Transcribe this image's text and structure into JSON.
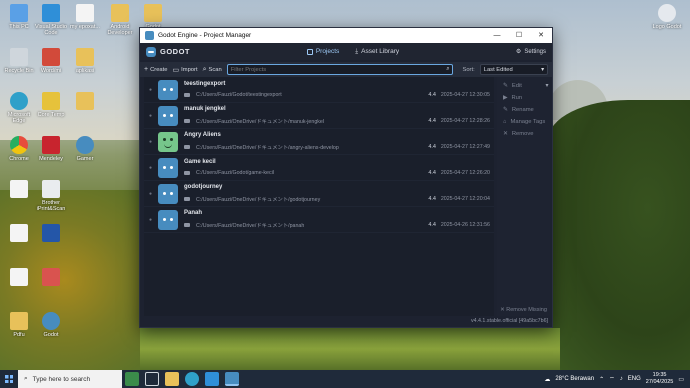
{
  "desktop": {
    "icons": [
      {
        "label": "This PC"
      },
      {
        "label": "Visual Studio Code"
      },
      {
        "label": "my epoxat..."
      },
      {
        "label": "Android Developer"
      },
      {
        "label": "Godot"
      },
      {
        "label": "Recycle Bin"
      },
      {
        "label": "Word/mi"
      },
      {
        "label": "aplikasi"
      },
      {
        "label": "Microsoft Edge"
      },
      {
        "label": "Core Temp"
      },
      {
        "label": "Chrome"
      },
      {
        "label": "Mendeley"
      },
      {
        "label": "Gamer"
      },
      {
        "label": "Brother iPrint&Scan"
      },
      {
        "label": "Pdfu"
      },
      {
        "label": "Godot"
      }
    ],
    "right_icon_label": "Logo Godot"
  },
  "window": {
    "title": "Godot Engine - Project Manager",
    "controls": {
      "minimize": "—",
      "maximize": "☐",
      "close": "✕"
    }
  },
  "header": {
    "logo_text": "GODOT",
    "tabs": [
      {
        "label": "Projects",
        "active": true
      },
      {
        "label": "Asset Library",
        "active": false
      }
    ],
    "settings_label": "Settings"
  },
  "toolbar": {
    "create_label": "Create",
    "import_label": "Import",
    "scan_label": "Scan",
    "filter_placeholder": "Filter Projects",
    "sort_label": "Sort:",
    "sort_value": "Last Edited"
  },
  "projects": [
    {
      "name": "teestingexport",
      "path": "C:/Users/Fauzi/Godot/teestingexport",
      "version": "4.4",
      "date": "2025-04-27 12:30:05",
      "icon": "godot"
    },
    {
      "name": "manuk jengkel",
      "path": "C:/Users/Fauzi/OneDrive/ドキュメント/manuk-jengkel",
      "version": "4.4",
      "date": "2025-04-27 12:28:26",
      "icon": "godot"
    },
    {
      "name": "Angry Aliens",
      "path": "C:/Users/Fauzi/OneDrive/ドキュメント/angry-aliens-develop",
      "version": "4.4",
      "date": "2025-04-27 12:27:49",
      "icon": "alien"
    },
    {
      "name": "Game kecil",
      "path": "C:/Users/Fauzi/Godot/game-kecil",
      "version": "4.4",
      "date": "2025-04-27 12:26:20",
      "icon": "godot"
    },
    {
      "name": "godotjourney",
      "path": "C:/Users/Fauzi/OneDrive/ドキュメント/godotjourney",
      "version": "4.4",
      "date": "2025-04-27 12:20:04",
      "icon": "godot"
    },
    {
      "name": "Panah",
      "path": "C:/Users/Fauzi/OneDrive/ドキュメント/panah",
      "version": "4.4",
      "date": "2025-04-26 12:31:56",
      "icon": "godot"
    }
  ],
  "side_actions": {
    "edit": "Edit",
    "run": "Run",
    "rename": "Rename",
    "manage_tags": "Manage Tags",
    "remove": "Remove",
    "remove_missing": "Remove Missing"
  },
  "version_label": "v4.4.1.stable.official [49a5bc7b6]",
  "taskbar": {
    "search_placeholder": "Type here to search",
    "weather": "28°C  Berawan",
    "language": "ENG",
    "time": "19:35",
    "date": "27/04/2025"
  }
}
